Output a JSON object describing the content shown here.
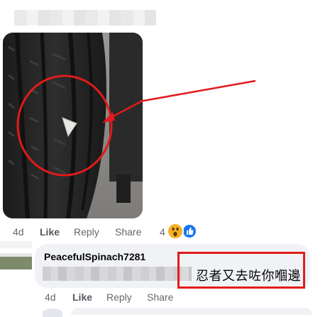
{
  "post": {
    "actions": {
      "time": "4d",
      "like": "Like",
      "reply": "Reply",
      "share": "Share",
      "reaction_count": "4"
    },
    "reactions": [
      {
        "icon": "wow-emoji-icon",
        "color": "#f7b125"
      },
      {
        "icon": "like-thumb-icon",
        "color": "#1877f2"
      }
    ]
  },
  "reply": {
    "author": "PeacefulSpinach7281",
    "text": "忍者又去咗你嗰邊",
    "actions": {
      "time": "4d",
      "like": "Like",
      "reply": "Reply",
      "share": "Share"
    }
  },
  "annotation_color": "#e11b1b"
}
